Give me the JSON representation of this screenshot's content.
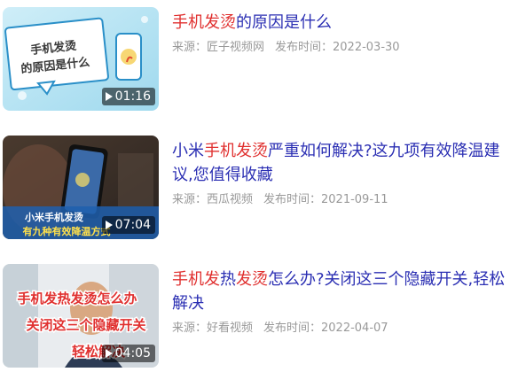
{
  "items": [
    {
      "title_parts": [
        "手机发烫",
        "的原因是什么"
      ],
      "source": "来源：匠子视频网",
      "time": "发布时间：2022-03-30",
      "duration": "01:16",
      "thumb_caption": [
        "手机发烫",
        "的原因是什么"
      ]
    },
    {
      "title_parts": [
        "小米",
        "手机发烫",
        "严重如何解决?这九项有效降温建议,您值得收藏"
      ],
      "source": "来源：西瓜视频",
      "time": "发布时间：2021-09-11",
      "duration": "07:04",
      "thumb_caption": [
        "小米手机发烫",
        "有九种有效降温方式"
      ]
    },
    {
      "title_parts": [
        "手机发",
        "热",
        "发烫",
        "怎么办?关闭这三个隐藏开关,轻松解决"
      ],
      "source": "来源：好看视频",
      "time": "发布时间：2022-04-07",
      "duration": "04:05",
      "thumb_caption": [
        "手机发热发烫怎么办",
        "关闭这三个隐藏开关",
        "轻松解决"
      ]
    }
  ],
  "colors": {
    "title": "#2b2fb3",
    "highlight": "#e0302f",
    "meta": "#999999"
  }
}
